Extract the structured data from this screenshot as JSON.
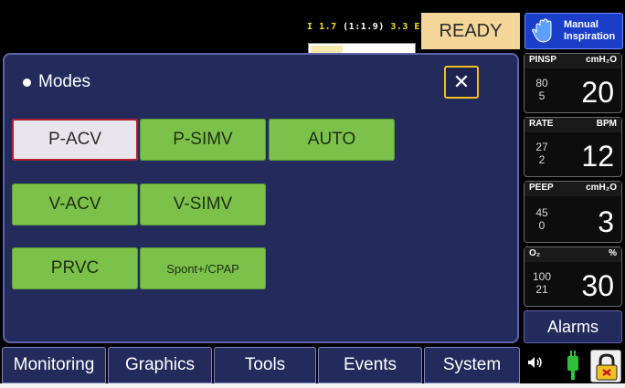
{
  "status": {
    "ie_marker": "I",
    "ie_value": "1.7",
    "ie_ratio": "(1:1.9)",
    "ie_e": "3.3 E",
    "ie_progress": 0.3,
    "ready_label": "READY",
    "manual_label_line1": "Manual",
    "manual_label_line2": "Inspiration"
  },
  "modes_panel": {
    "title": "Modes",
    "close_symbol": "✕",
    "modes": [
      {
        "label": "P-ACV",
        "selected": true
      },
      {
        "label": "P-SIMV",
        "selected": false
      },
      {
        "label": "AUTO",
        "selected": false
      },
      {
        "label": "V-ACV",
        "selected": false
      },
      {
        "label": "V-SIMV",
        "selected": false
      },
      {
        "label": "PRVC",
        "selected": false
      },
      {
        "label": "Spont+/CPAP",
        "selected": false
      }
    ]
  },
  "parameters": [
    {
      "name": "PINSP",
      "unit": "cmH₂O",
      "high": "80",
      "low": "5",
      "value": "20"
    },
    {
      "name": "RATE",
      "unit": "BPM",
      "high": "27",
      "low": "2",
      "value": "12"
    },
    {
      "name": "PEEP",
      "unit": "cmH₂O",
      "high": "45",
      "low": "0",
      "value": "3"
    },
    {
      "name": "O₂",
      "unit": "%",
      "high": "100",
      "low": "21",
      "value": "30"
    }
  ],
  "alarms_label": "Alarms",
  "tabs": [
    "Monitoring",
    "Graphics",
    "Tools",
    "Events",
    "System"
  ],
  "icons": {
    "hand": "hand-icon",
    "speaker": "speaker-icon",
    "plug": "power-plug-icon",
    "lock": "lock-icon"
  },
  "colors": {
    "panel_bg": "#232b5c",
    "mode_green": "#7cc24a",
    "ready_bg": "#f4d69a",
    "manual_blue": "#1a3ec8",
    "selected_border": "#b02030"
  }
}
